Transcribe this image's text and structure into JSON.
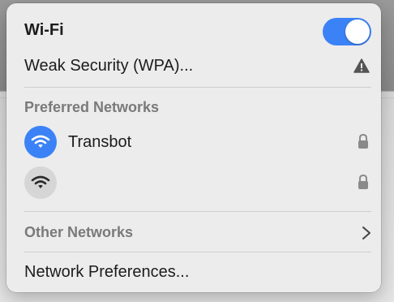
{
  "header": {
    "title": "Wi-Fi",
    "toggle_state": "on",
    "accent_color": "#3b82f6"
  },
  "current_network": {
    "label": "Weak Security (WPA)...",
    "status_icon": "warning-icon"
  },
  "preferred_networks": {
    "heading": "Preferred Networks",
    "items": [
      {
        "name": "Transbot",
        "signal_icon": "wifi-icon",
        "connected": true,
        "icon_bg": "#3b82f6",
        "lock_icon": "lock-icon"
      },
      {
        "name": "",
        "signal_icon": "wifi-icon",
        "connected": false,
        "icon_bg": "#d6d6d6",
        "lock_icon": "lock-icon"
      }
    ]
  },
  "other_networks": {
    "label": "Other Networks",
    "chevron_icon": "chevron-right-icon"
  },
  "footer": {
    "preferences_label": "Network Preferences..."
  }
}
